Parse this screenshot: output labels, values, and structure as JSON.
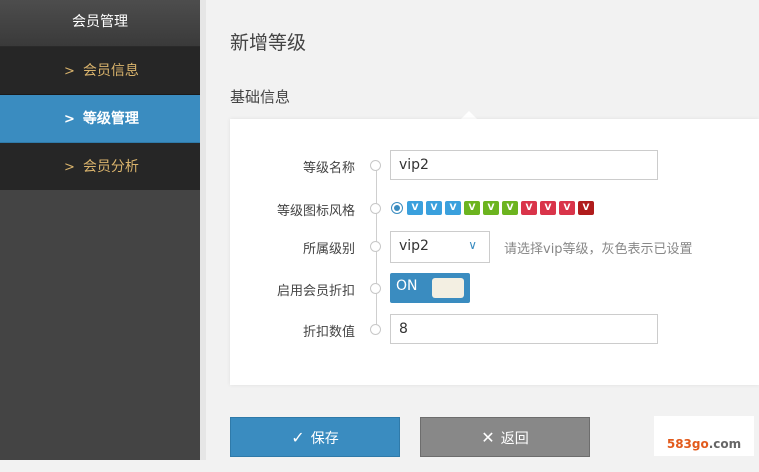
{
  "sidebar": {
    "header": "会员管理",
    "items": [
      {
        "label": "会员信息",
        "active": false
      },
      {
        "label": "等级管理",
        "active": true
      },
      {
        "label": "会员分析",
        "active": false
      }
    ]
  },
  "main": {
    "title": "新增等级",
    "section": "基础信息"
  },
  "form": {
    "level_name": {
      "label": "等级名称",
      "value": "vip2"
    },
    "icon_style": {
      "label": "等级图标风格",
      "icons": [
        {
          "name": "level-icon-blue-1",
          "color": "#3aa0dd",
          "text": "V"
        },
        {
          "name": "level-icon-blue-2",
          "color": "#3aa0dd",
          "text": "V"
        },
        {
          "name": "level-icon-blue-3",
          "color": "#3aa0dd",
          "text": "V"
        },
        {
          "name": "level-icon-green-1",
          "color": "#6cb41f",
          "text": "V"
        },
        {
          "name": "level-icon-green-2",
          "color": "#6cb41f",
          "text": "V"
        },
        {
          "name": "level-icon-green-3",
          "color": "#6cb41f",
          "text": "V"
        },
        {
          "name": "level-icon-red-1",
          "color": "#d9344a",
          "text": "V"
        },
        {
          "name": "level-icon-red-2",
          "color": "#d9344a",
          "text": "V"
        },
        {
          "name": "level-icon-red-3",
          "color": "#d9344a",
          "text": "V"
        },
        {
          "name": "level-icon-darkred",
          "color": "#b01c1c",
          "text": "V"
        }
      ]
    },
    "parent_level": {
      "label": "所属级别",
      "value": "vip2",
      "hint": "请选择vip等级，灰色表示已设置"
    },
    "enable_discount": {
      "label": "启用会员折扣",
      "state": "ON"
    },
    "discount_value": {
      "label": "折扣数值",
      "value": "8"
    }
  },
  "buttons": {
    "save": "保存",
    "back": "返回"
  },
  "watermark": {
    "prefix": "583go",
    "suffix": ".com"
  },
  "colors": {
    "accent": "#3a8cc0",
    "sidebar": "#3b3b3b",
    "gold": "#d9b36c"
  }
}
